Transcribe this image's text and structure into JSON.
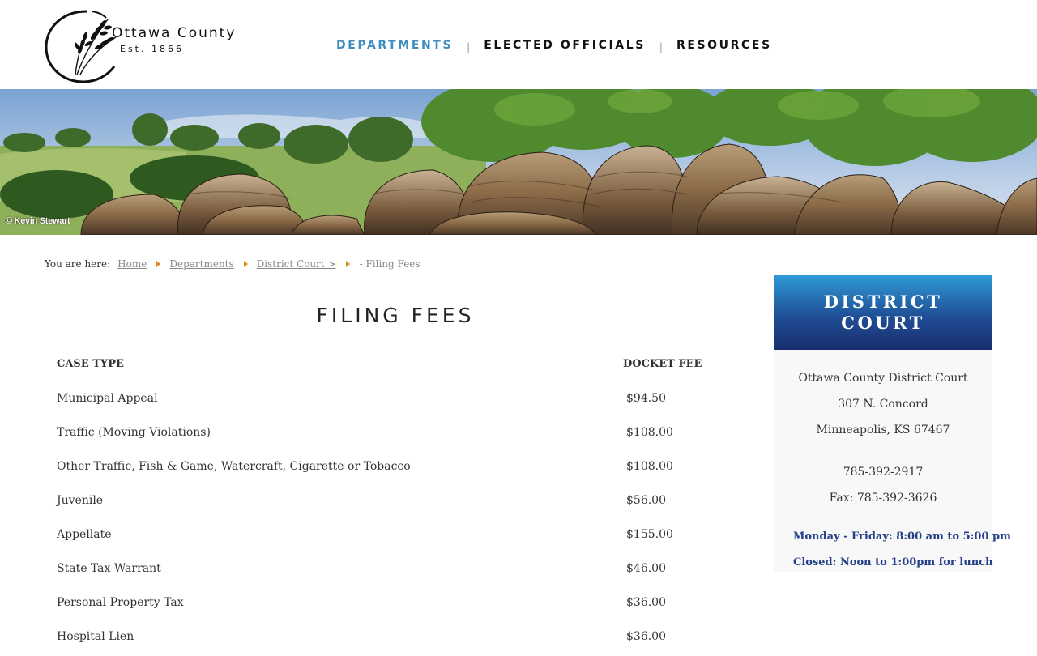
{
  "header": {
    "logo_name": "Ottawa County",
    "logo_est": "Est. 1866",
    "nav": [
      {
        "label": "DEPARTMENTS"
      },
      {
        "label": "ELECTED OFFICIALS"
      },
      {
        "label": "RESOURCES"
      }
    ],
    "nav_separator": "|"
  },
  "banner": {
    "credit": "© Kevin Stewart"
  },
  "breadcrumb": {
    "prefix": "You are here:",
    "home": "Home",
    "departments": "Departments",
    "district_court": "District Court >",
    "current": "- Filing Fees"
  },
  "page_title": "FILING FEES",
  "table": {
    "headers": {
      "case_type": "CASE TYPE",
      "docket_fee": "DOCKET FEE"
    },
    "rows": [
      {
        "case": "Municipal Appeal",
        "fee": "$94.50"
      },
      {
        "case": "Traffic (Moving Violations)",
        "fee": "$108.00"
      },
      {
        "case": "Other Traffic, Fish & Game, Watercraft, Cigarette or Tobacco",
        "fee": "$108.00"
      },
      {
        "case": "Juvenile",
        "fee": "$56.00"
      },
      {
        "case": "Appellate",
        "fee": "$155.00"
      },
      {
        "case": "State Tax Warrant",
        "fee": "$46.00"
      },
      {
        "case": "Personal Property Tax",
        "fee": "$36.00"
      },
      {
        "case": "Hospital Lien",
        "fee": "$36.00"
      }
    ]
  },
  "sidebar": {
    "title": "DISTRICT COURT",
    "name": "Ottawa County District Court",
    "street": "307 N. Concord",
    "city": "Minneapolis, KS  67467",
    "phone": "785-392-2917",
    "fax": "Fax: 785-392-3626",
    "hours": "Monday - Friday: 8:00 am to 5:00 pm",
    "closed": "Closed: Noon to 1:00pm for lunch"
  },
  "colors": {
    "nav_active": "#3e8fbf",
    "breadcrumb_arrow": "#e08a1e",
    "sidebar_gradient_top": "#2f9ad6",
    "sidebar_gradient_bottom": "#1a2e6e",
    "hours_text": "#243f86"
  }
}
